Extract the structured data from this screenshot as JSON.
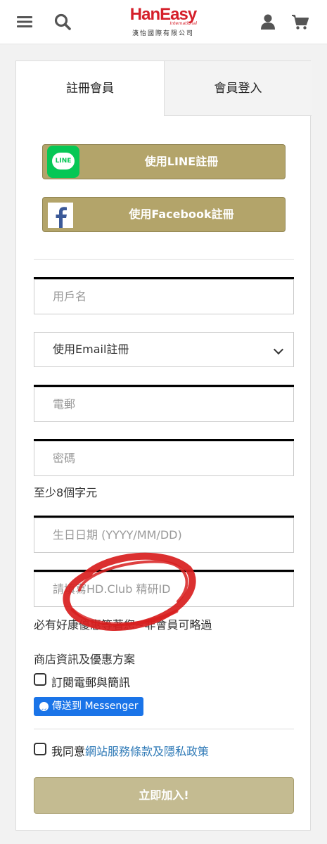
{
  "header": {
    "logo_main": "HanEasy",
    "logo_intl": "International",
    "logo_sub": "漢怡國際有限公司"
  },
  "tabs": [
    {
      "label": "註冊會員",
      "active": true
    },
    {
      "label": "會員登入",
      "active": false
    }
  ],
  "social": {
    "line_label": "使用LINE註冊",
    "line_icon_text": "LINE",
    "facebook_label": "使用Facebook註冊"
  },
  "form": {
    "username_placeholder": "用戶名",
    "register_method_value": "使用Email註冊",
    "email_placeholder": "電郵",
    "password_placeholder": "密碼",
    "password_hint": "至少8個字元",
    "birthday_placeholder": "生日日期 (YYYY/MM/DD)",
    "club_id_placeholder": "請填寫HD.Club 精研ID",
    "club_id_hint": "必有好康優惠等著您~非會員可略過",
    "store_info_heading": "商店資訊及優惠方案",
    "subscribe_label": "訂閱電郵與簡訊",
    "messenger_label": "傳送到 Messenger",
    "agree_prefix": "我同意",
    "agree_link": "網站服務條款及隱私政策",
    "submit_label": "立即加入!"
  },
  "colors": {
    "brand_red": "#d51f2a",
    "gold": "#b3a46a",
    "gold_light": "#c4bb91",
    "line_green": "#06c755",
    "facebook_blue": "#3b5998",
    "messenger_blue": "#1a74e8",
    "link_blue": "#2f7ab7"
  }
}
